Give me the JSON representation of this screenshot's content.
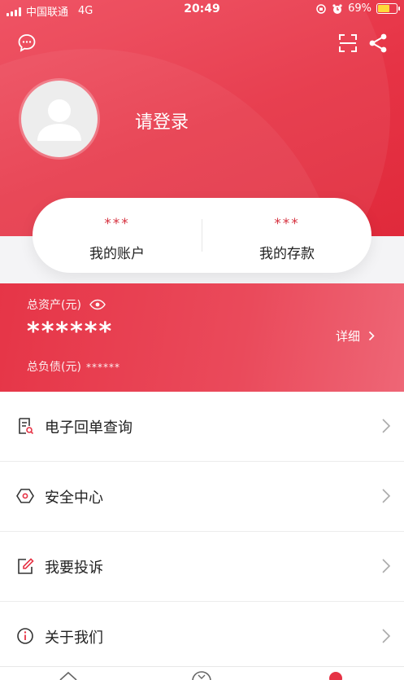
{
  "status_bar": {
    "carrier": "中国联通",
    "network": "4G",
    "time": "20:49",
    "battery_percent": "69%",
    "battery_level": 0.69
  },
  "header": {
    "icons": [
      "message-icon",
      "scan-icon",
      "share-icon"
    ],
    "login_text": "请登录"
  },
  "summary_card": {
    "account": {
      "value": "***",
      "label": "我的账户"
    },
    "deposit": {
      "value": "***",
      "label": "我的存款"
    }
  },
  "assets": {
    "total_label": "总资产(元)",
    "total_value": "******",
    "detail_label": "详细",
    "debt_label": "总负债(元)",
    "debt_value": "******"
  },
  "menu": [
    {
      "label": "电子回单查询",
      "icon": "receipt-search-icon"
    },
    {
      "label": "安全中心",
      "icon": "shield-icon"
    },
    {
      "label": "我要投诉",
      "icon": "edit-icon"
    },
    {
      "label": "关于我们",
      "icon": "info-icon"
    }
  ],
  "colors": {
    "brand_red": "#e63345",
    "star_red": "#d6323f",
    "battery_yellow": "#ffd83a"
  }
}
